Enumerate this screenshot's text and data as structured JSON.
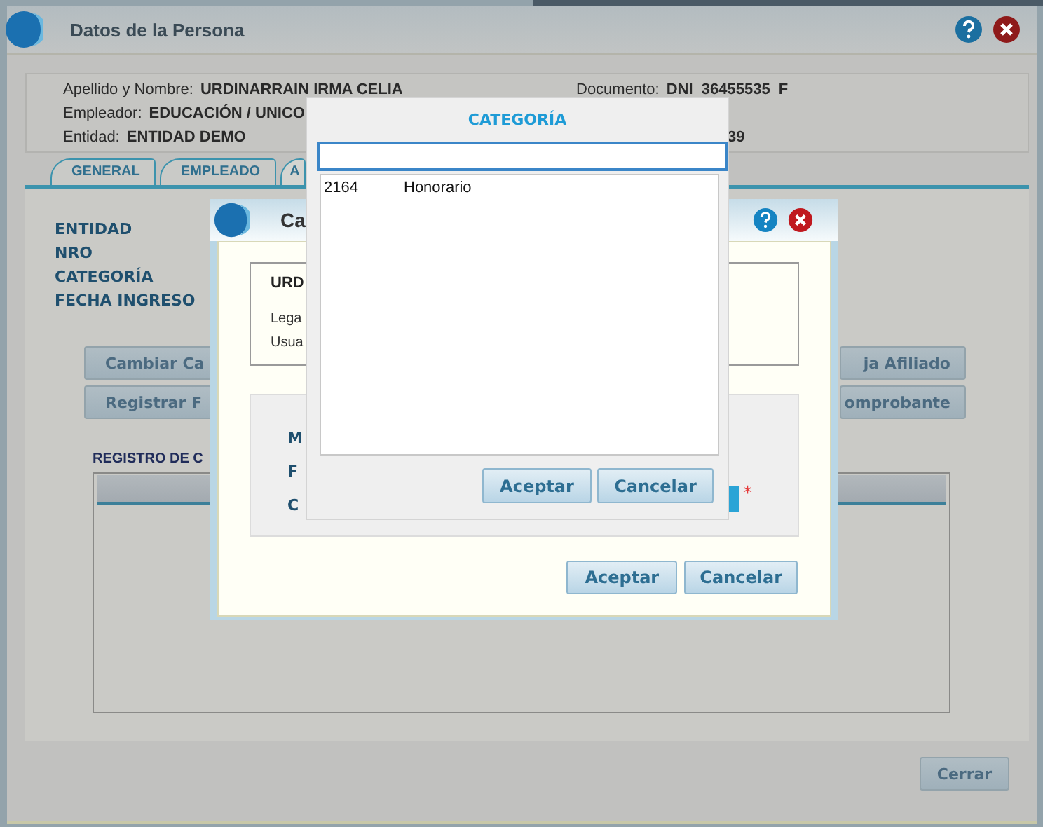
{
  "window": {
    "title": "Datos de la Persona"
  },
  "person_info": [
    {
      "left": {
        "label": "Apellido y Nombre:",
        "value": "URDINARRAIN IRMA CELIA"
      },
      "right": {
        "label": "Documento:",
        "value": "DNI  36455535  F"
      }
    },
    {
      "left": {
        "label": "Empleador:",
        "value": "EDUCACIÓN / UNICO"
      }
    },
    {
      "left": {
        "label": "Entidad:",
        "value": "ENTIDAD DEMO"
      },
      "right": {
        "value": "39"
      }
    }
  ],
  "tabs": [
    {
      "label": "GENERAL",
      "selected": false
    },
    {
      "label": "EMPLEADO",
      "selected": false
    },
    {
      "label": "A",
      "selected": true
    }
  ],
  "tab_panel": {
    "labels": [
      "ENTIDAD",
      "NRO",
      "CATEGORÍA",
      "FECHA INGRESO"
    ],
    "button_rows": [
      {
        "left": "Cambiar Ca",
        "right": "ja Afiliado"
      },
      {
        "left": "Registrar F",
        "right": "omprobante"
      }
    ],
    "section_title": "REGISTRO DE C"
  },
  "close_button": "Cerrar",
  "dialog": {
    "title": "Ca",
    "person_box": {
      "name": "URD",
      "lines": [
        "Lega",
        "Usua"
      ]
    },
    "form_labels": [
      "M",
      "F",
      "C"
    ],
    "required_mark": "*",
    "buttons": [
      "Aceptar",
      "Cancelar"
    ]
  },
  "picker": {
    "title": "CATEGORÍA",
    "rows": [
      {
        "code": "2164",
        "name": "Honorario"
      }
    ],
    "buttons": [
      "Aceptar",
      "Cancelar"
    ]
  }
}
